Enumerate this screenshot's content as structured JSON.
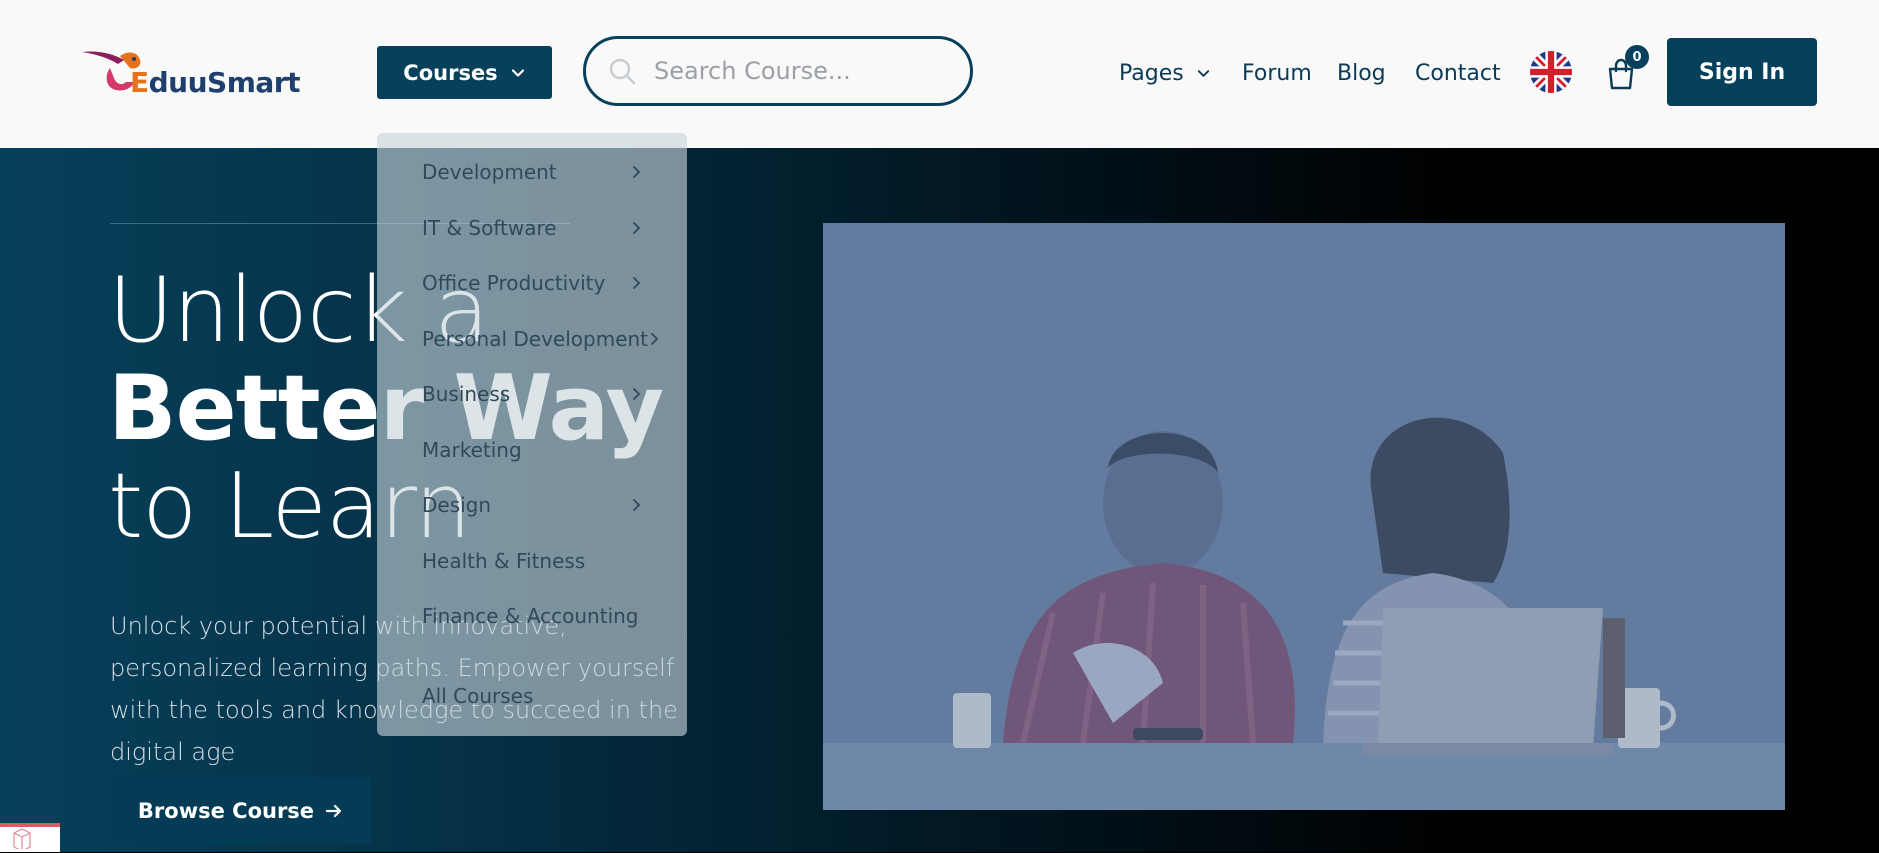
{
  "header": {
    "logo": {
      "prefix": "E",
      "rest": "duuSmart"
    },
    "courses_label": "Courses",
    "search_placeholder": "Search Course...",
    "nav": {
      "pages": "Pages",
      "forum": "Forum",
      "blog": "Blog",
      "contact": "Contact"
    },
    "cart_count": "0",
    "sign_in": "Sign In"
  },
  "courses_menu": {
    "items": [
      {
        "label": "Development",
        "has_submenu": true
      },
      {
        "label": "IT & Software",
        "has_submenu": true
      },
      {
        "label": "Office Productivity",
        "has_submenu": true
      },
      {
        "label": "Personal Development",
        "has_submenu": true
      },
      {
        "label": "Business",
        "has_submenu": true
      },
      {
        "label": "Marketing",
        "has_submenu": false
      },
      {
        "label": "Design",
        "has_submenu": true
      },
      {
        "label": "Health & Fitness",
        "has_submenu": false
      },
      {
        "label": "Finance & Accounting",
        "has_submenu": false
      },
      {
        "label": "All Courses",
        "has_submenu": false
      }
    ]
  },
  "hero": {
    "title_line1": "Unlock a",
    "title_line2": "Better Way",
    "title_line3": "to Learn",
    "subtitle": "Unlock your potential with innovative, personalized learning paths. Empower yourself with the tools and knowledge to succeed in the digital age",
    "browse_button": "Browse Course"
  },
  "colors": {
    "brand_primary": "#07405a",
    "header_bg": "#f9f9f9",
    "logo_accent": "#e5721c",
    "hero_image_tint": "#627b9e"
  },
  "icons": [
    "chevron-down-icon",
    "search-icon",
    "uk-flag-icon",
    "cart-icon",
    "arrow-right-icon",
    "chevron-right-icon"
  ]
}
